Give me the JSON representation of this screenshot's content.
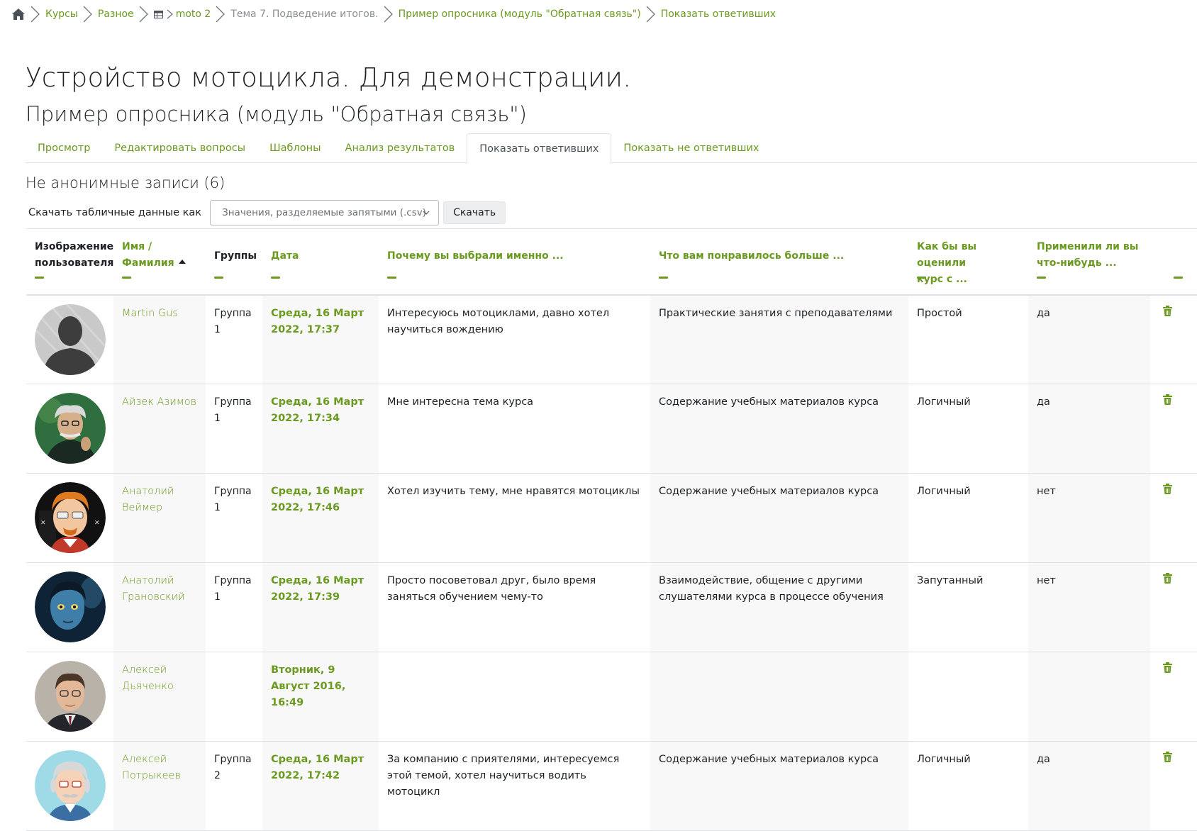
{
  "breadcrumb": {
    "items": [
      {
        "label": "Курсы",
        "style": "link"
      },
      {
        "label": "Разное",
        "style": "link"
      },
      {
        "label": "moto 2",
        "style": "link"
      },
      {
        "label": "Тема 7. Подведение итогов.",
        "style": "muted"
      },
      {
        "label": "Пример опросника (модуль \"Обратная связь\")",
        "style": "link"
      },
      {
        "label": "Показать ответивших",
        "style": "link"
      }
    ]
  },
  "page": {
    "course_title": "Устройство мотоцикла. Для демонстрации.",
    "activity_title": "Пример опросника (модуль \"Обратная связь\")"
  },
  "tabs": [
    {
      "label": "Просмотр",
      "active": false
    },
    {
      "label": "Редактировать вопросы",
      "active": false
    },
    {
      "label": "Шаблоны",
      "active": false
    },
    {
      "label": "Анализ результатов",
      "active": false
    },
    {
      "label": "Показать ответивших",
      "active": true
    },
    {
      "label": "Показать не ответивших",
      "active": false
    }
  ],
  "section": {
    "title": "Не анонимные записи (6)"
  },
  "download": {
    "label": "Скачать табличные данные как",
    "selected": "Значения, разделяемые запятыми (.csv)",
    "button": "Скачать"
  },
  "table": {
    "headers": {
      "picture_l1": "Изображение",
      "picture_l2": "пользователя",
      "name_l1": "Имя /",
      "name_l2": "Фамилия",
      "groups": "Группы",
      "date": "Дата",
      "q1": "Почему вы выбрали именно ...",
      "q2": "Что вам понравилось больше ...",
      "q3_l1": "Как бы вы оценили",
      "q3_l2": "курс с ...",
      "q4_l1": "Применили ли вы",
      "q4_l2": "что-нибудь ..."
    },
    "rows": [
      {
        "avatar": "default-silhouette",
        "name": "Martin Gus",
        "group": "Группа 1",
        "date": "Среда, 16 Март 2022, 17:37",
        "q1": "Интересуюсь мотоциклами, давно хотел научиться вождению",
        "q2": "Практические занятия с преподавателями",
        "q3": "Простой",
        "q4": "да"
      },
      {
        "avatar": "photo-green",
        "name": "Айзек Азимов",
        "group": "Группа 1",
        "date": "Среда, 16 Март 2022, 17:34",
        "q1": "Мне интересна тема курса",
        "q2": "Содержание учебных материалов курса",
        "q3": "Логичный",
        "q4": "да"
      },
      {
        "avatar": "cartoon-orange",
        "name": "Анатолий Веймер",
        "group": "Группа 1",
        "date": "Среда, 16 Март 2022, 17:46",
        "q1": "Хотел изучить тему, мне нравятся мотоциклы",
        "q2": "Содержание учебных материалов курса",
        "q3": "Логичный",
        "q4": "нет"
      },
      {
        "avatar": "photo-blue",
        "name": "Анатолий Грановский",
        "group": "Группа 1",
        "date": "Среда, 16 Март 2022, 17:39",
        "q1": "Просто посоветовал друг, было время заняться обучением чему-то",
        "q2": "Взаимодействие, общение с другими слушателями курса в процессе обучения",
        "q3": "Запутанный",
        "q4": "нет"
      },
      {
        "avatar": "photo-portrait",
        "name": "Алексей Дьяченко",
        "group": "",
        "date": "Вторник, 9 Август 2016, 16:49",
        "q1": "",
        "q2": "",
        "q3": "",
        "q4": ""
      },
      {
        "avatar": "cartoon-grey",
        "name": "Алексей Потрыкеев",
        "group": "Группа 2",
        "date": "Среда, 16 Март 2022, 17:42",
        "q1": "За компанию с приятелями, интересуемся этой темой, хотел научиться водить мотоцикл",
        "q2": "Содержание учебных материалов курса",
        "q3": "Логичный",
        "q4": "да"
      }
    ]
  },
  "icons": {
    "home": "home-icon",
    "separator": "chevron-right-icon",
    "delete": "trash-icon"
  },
  "colors": {
    "accent": "#6a9a1f",
    "text": "#1d2125",
    "muted": "#8a8f94",
    "row_shade": "#f8f8f8"
  }
}
